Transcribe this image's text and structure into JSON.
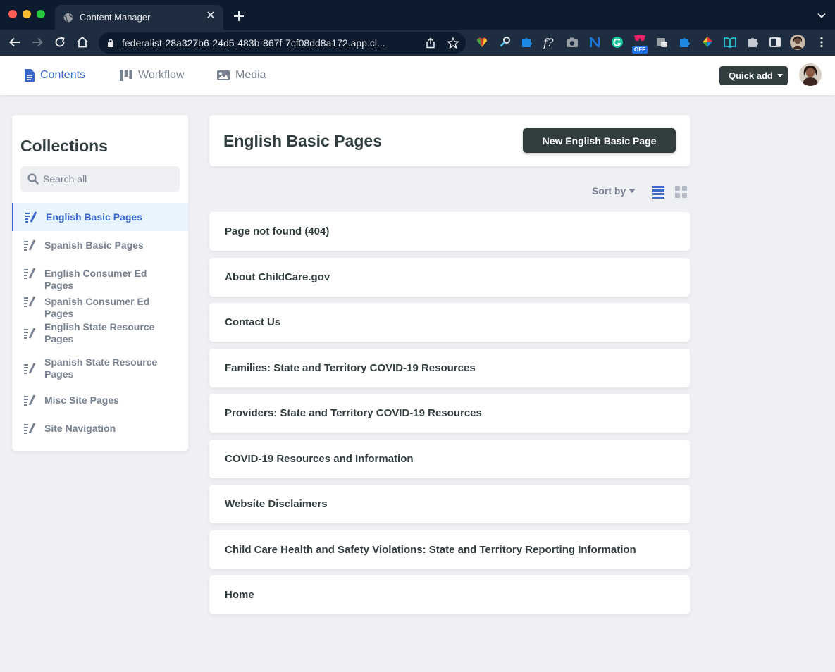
{
  "browser": {
    "tab_title": "Content Manager",
    "tab_close": "✕",
    "url": "federalist-28a327b6-24d5-483b-867f-7cf08dd8a172.app.cl..."
  },
  "extensions": [
    "color-picker-icon",
    "search-key-icon",
    "puzzle-icon",
    "formula-icon",
    "camera-icon",
    "notion-icon",
    "grammarly-icon",
    "off-extension-icon",
    "tab-manager-icon",
    "puzzle-icon",
    "palette-icon",
    "reader-icon",
    "extensions-icon",
    "side-panel-icon"
  ],
  "extension_badge": "OFF",
  "app": {
    "nav": {
      "contents": "Contents",
      "workflow": "Workflow",
      "media": "Media"
    },
    "quick_add": "Quick add"
  },
  "sidebar": {
    "title": "Collections",
    "search_placeholder": "Search all",
    "items": [
      {
        "label": "English Basic Pages",
        "active": true
      },
      {
        "label": "Spanish Basic Pages"
      },
      {
        "label": "English Consumer Ed Pages"
      },
      {
        "label": "Spanish Consumer Ed Pages"
      },
      {
        "label": "English State Resource Pages"
      },
      {
        "label": "Spanish State Resource Pages"
      },
      {
        "label": "Misc Site Pages"
      },
      {
        "label": "Site Navigation"
      }
    ]
  },
  "main": {
    "title": "English Basic Pages",
    "new_button": "New English Basic Page",
    "sort_by": "Sort by",
    "entries": [
      "Page not found (404)",
      "About ChildCare.gov",
      "Contact Us",
      "Families: State and Territory COVID-19 Resources",
      "Providers: State and Territory COVID-19 Resources",
      "COVID-19 Resources and Information",
      "Website Disclaimers",
      "Child Care Health and Safety Violations: State and Territory Reporting Information",
      "Home"
    ]
  },
  "colors": {
    "accent": "#3a69c7",
    "dark": "#313d3e",
    "muted": "#798291",
    "background": "#eff0f4",
    "active_bg": "#e8f5fe"
  }
}
